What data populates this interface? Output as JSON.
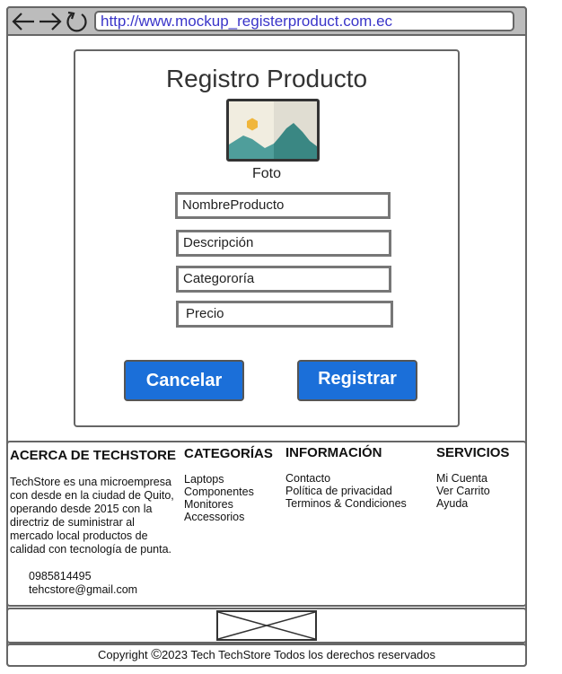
{
  "browser": {
    "url": "http://www.mockup_registerproduct.com.ec",
    "icons": [
      "back-arrow-icon",
      "forward-arrow-icon",
      "refresh-icon"
    ]
  },
  "form": {
    "title": "Registro Producto",
    "photo_label": "Foto",
    "fields": {
      "name": "NombreProducto",
      "description": "Descripción",
      "category": "Categororía",
      "price": "Precio"
    },
    "cancel_label": "Cancelar",
    "register_label": "Registrar",
    "accent_color": "#1b6fd9"
  },
  "footer": {
    "about": {
      "title": "ACERCA DE TECHSTORE",
      "text_lines": [
        "TechStore es una microempresa",
        "con desde en la ciudad de Quito,",
        "operando desde 2015 con la",
        "directriz de suministrar al",
        "mercado local productos de",
        "calidad con tecnología de punta."
      ],
      "phone": "0985814495",
      "email": "tehcstore@gmail.com"
    },
    "categories": {
      "title": "CATEGORÍAS",
      "items": [
        "Laptops",
        "Componentes",
        "Monitores",
        "Accessorios"
      ]
    },
    "information": {
      "title": "INFORMACIÓN",
      "items": [
        "Contacto",
        "Política de privacidad",
        "Terminos & Condiciones"
      ]
    },
    "services": {
      "title": "SERVICIOS",
      "items": [
        "Mi Cuenta",
        "Ver Carrito",
        "Ayuda"
      ]
    },
    "copyright_symbol": "©",
    "copyright_text": "2023 Tech TechStore Todos los derechos reservados"
  }
}
